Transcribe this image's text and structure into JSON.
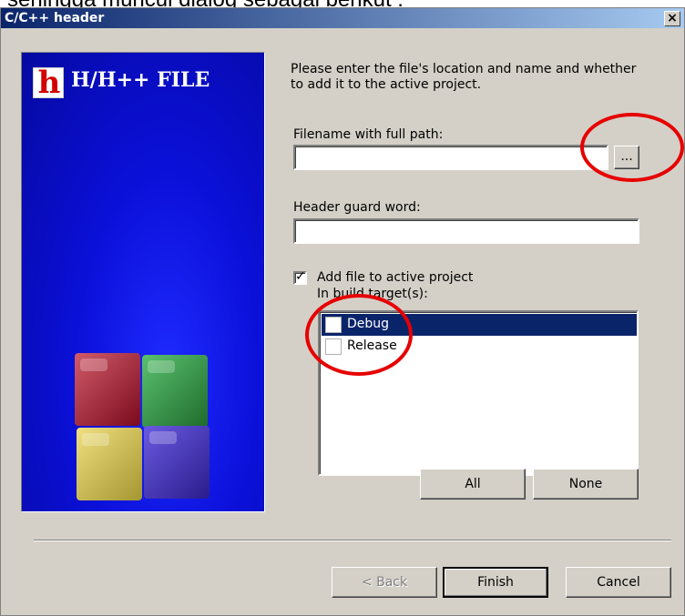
{
  "caption": "sehingga muncul dialog sebagai berikut :",
  "window": {
    "title": "C/C++ header",
    "close_glyph": "×"
  },
  "side_panel": {
    "logo_letter": "h",
    "logo_text": "H/H++ FILE"
  },
  "form": {
    "intro": "Please enter the file's location and name and whether to add it to the active project.",
    "filename_label": "Filename with full path:",
    "filename_value": "",
    "browse_label": "...",
    "guard_label": "Header guard word:",
    "guard_value": "",
    "add_to_project_label": "Add file to active project",
    "add_to_project_checked": true,
    "check_glyph": "✓",
    "build_targets_label": "In build target(s):",
    "targets": [
      {
        "label": "Debug",
        "selected": true,
        "checked": false
      },
      {
        "label": "Release",
        "selected": false,
        "checked": false
      }
    ],
    "all_label": "All",
    "none_label": "None"
  },
  "footer": {
    "back_label": "< Back",
    "finish_label": "Finish",
    "cancel_label": "Cancel"
  },
  "colors": {
    "annotation": "#e60000",
    "title_gradient_start": "#0a246a",
    "panel_blue": "#0b10d8",
    "dialog_bg": "#d4d0c8"
  }
}
